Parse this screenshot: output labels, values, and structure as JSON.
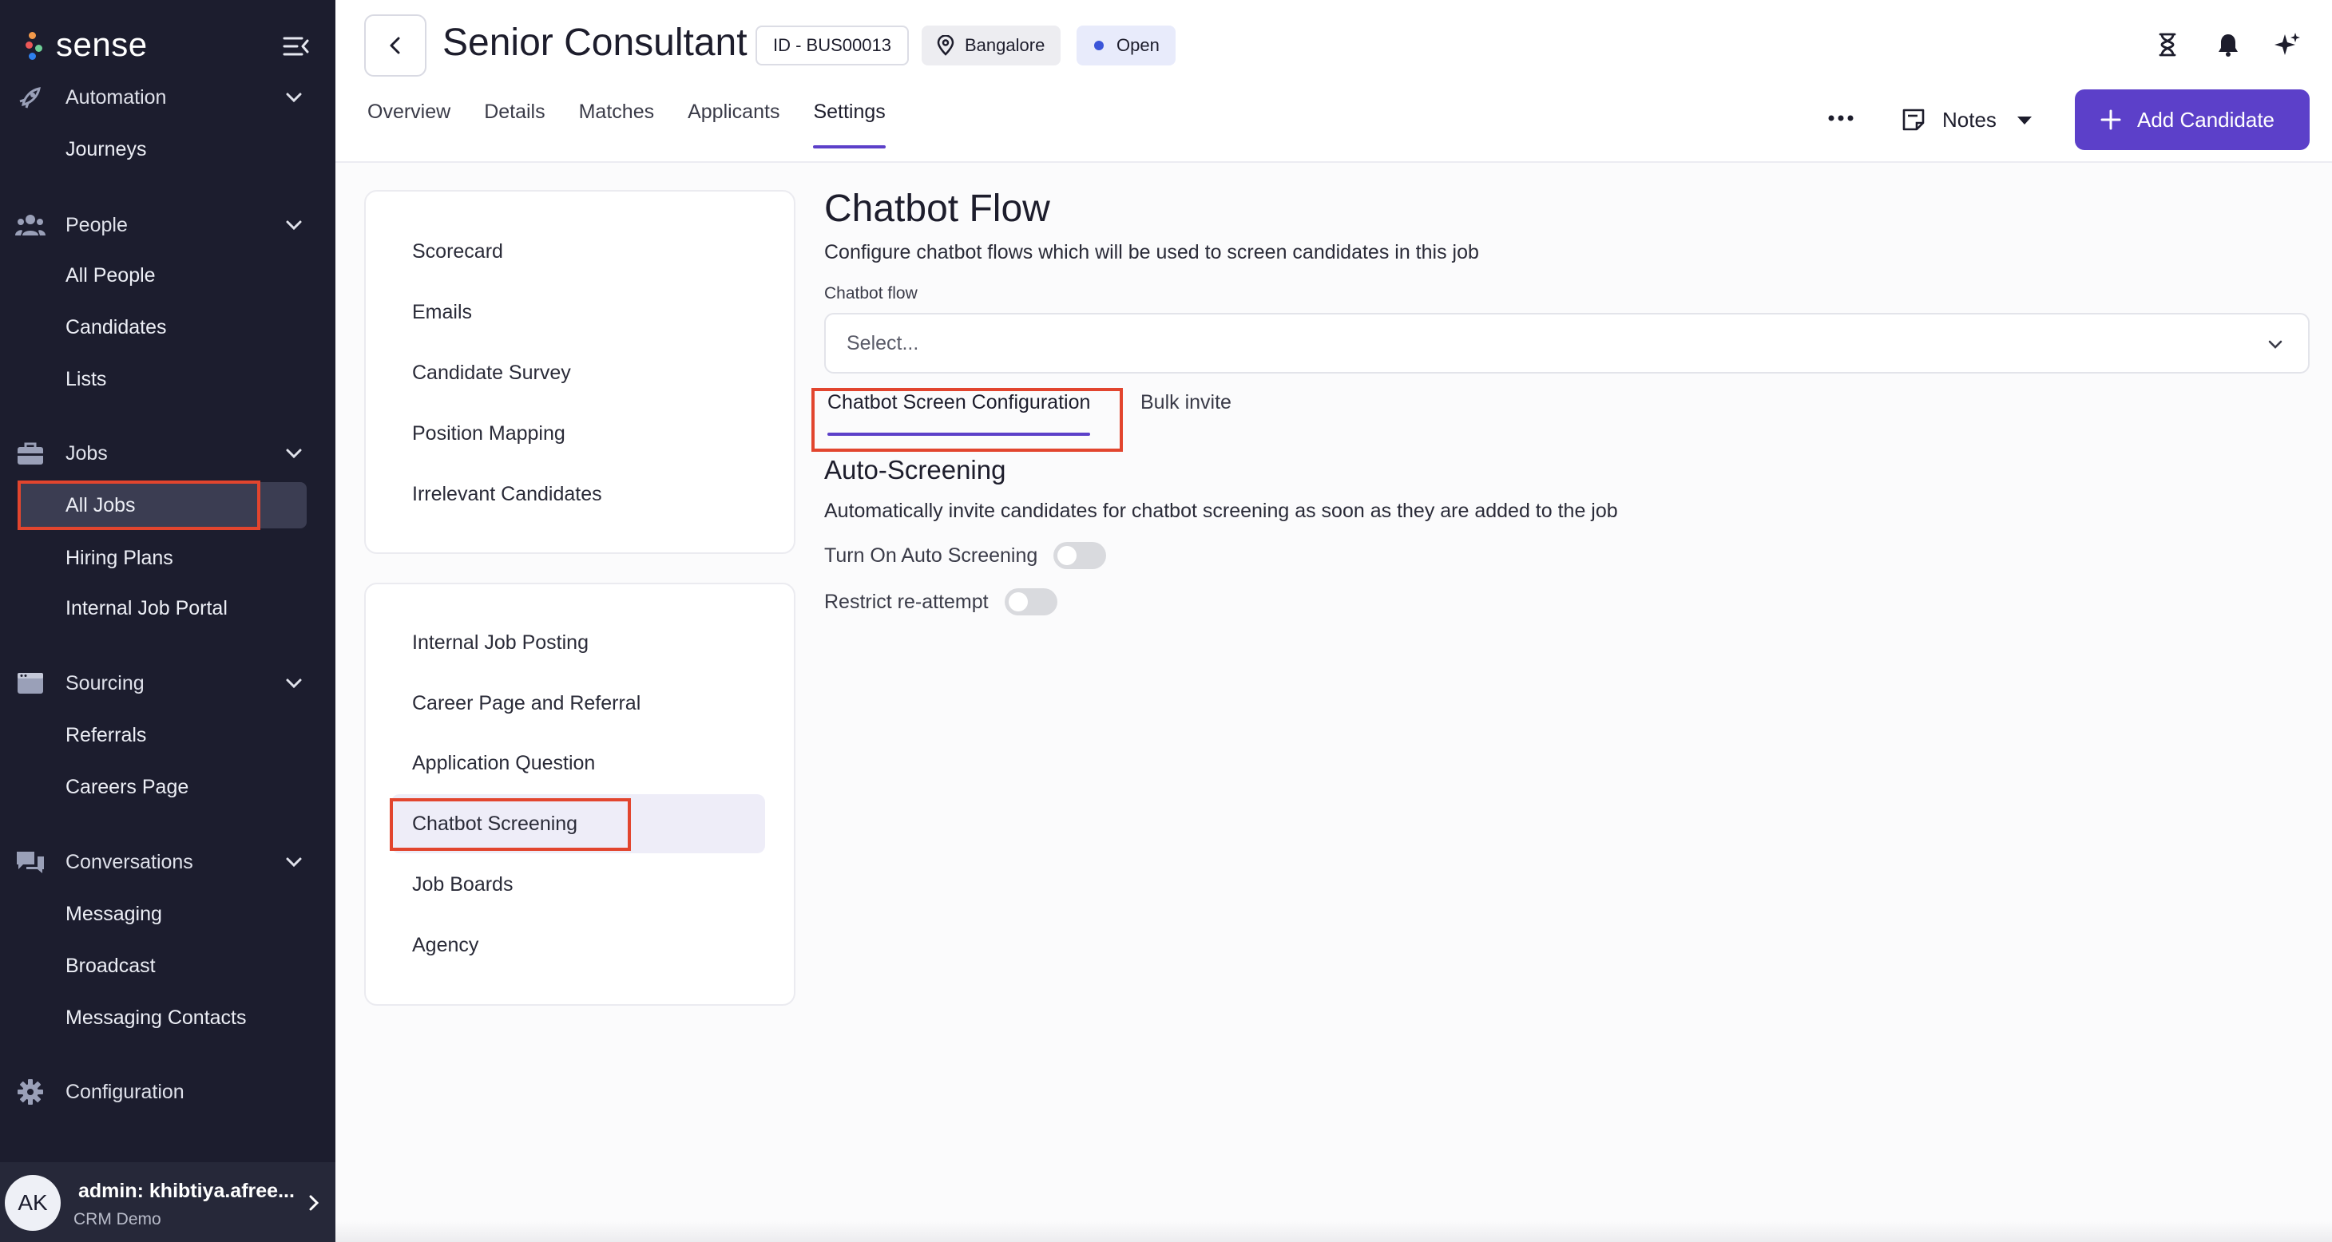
{
  "brand": {
    "name": "sense"
  },
  "sidebar": {
    "sections": [
      {
        "label": "Automation",
        "icon": "rocket-icon",
        "items": [
          {
            "label": "Journeys"
          }
        ]
      },
      {
        "label": "People",
        "icon": "people-icon",
        "items": [
          {
            "label": "All People"
          },
          {
            "label": "Candidates"
          },
          {
            "label": "Lists"
          }
        ]
      },
      {
        "label": "Jobs",
        "icon": "briefcase-icon",
        "items": [
          {
            "label": "All Jobs",
            "active": true
          },
          {
            "label": "Hiring Plans"
          },
          {
            "label": "Internal Job Portal"
          }
        ]
      },
      {
        "label": "Sourcing",
        "icon": "browser-icon",
        "items": [
          {
            "label": "Referrals"
          },
          {
            "label": "Careers Page"
          }
        ]
      },
      {
        "label": "Conversations",
        "icon": "chat-icon",
        "items": [
          {
            "label": "Messaging"
          },
          {
            "label": "Broadcast"
          },
          {
            "label": "Messaging Contacts"
          }
        ]
      }
    ],
    "configuration": {
      "label": "Configuration",
      "icon": "gear-icon"
    },
    "user": {
      "initials": "AK",
      "name": "admin: khibtiya.afree...",
      "org": "CRM Demo"
    }
  },
  "header": {
    "title": "Senior Consultant",
    "job_id": "ID - BUS00013",
    "location": "Bangalore",
    "status": "Open",
    "status_color": "#3b55d9",
    "tabs": [
      {
        "label": "Overview"
      },
      {
        "label": "Details"
      },
      {
        "label": "Matches"
      },
      {
        "label": "Applicants"
      },
      {
        "label": "Settings",
        "active": true
      }
    ],
    "notes_label": "Notes",
    "add_button_label": "Add Candidate",
    "accent_color": "#5c40c9"
  },
  "settings_nav": {
    "group1": [
      {
        "label": "Scorecard"
      },
      {
        "label": "Emails"
      },
      {
        "label": "Candidate Survey"
      },
      {
        "label": "Position Mapping"
      },
      {
        "label": "Irrelevant Candidates"
      }
    ],
    "group2": [
      {
        "label": "Internal Job Posting"
      },
      {
        "label": "Career Page and Referral"
      },
      {
        "label": "Application Question"
      },
      {
        "label": "Chatbot Screening",
        "active": true
      },
      {
        "label": "Job Boards"
      },
      {
        "label": "Agency"
      }
    ]
  },
  "main": {
    "title": "Chatbot Flow",
    "description": "Configure chatbot flows which will be used to screen candidates in this job",
    "field_label": "Chatbot flow",
    "select_placeholder": "Select...",
    "sub_tabs": [
      {
        "label": "Chatbot Screen Configuration",
        "active": true
      },
      {
        "label": "Bulk invite"
      }
    ],
    "section_title": "Auto-Screening",
    "section_description": "Automatically invite candidates for chatbot screening as soon as they are added to the job",
    "toggles": [
      {
        "label": "Turn On Auto Screening",
        "on": false
      },
      {
        "label": "Restrict re-attempt",
        "on": false
      }
    ]
  },
  "highlight_color": "#e2452e"
}
